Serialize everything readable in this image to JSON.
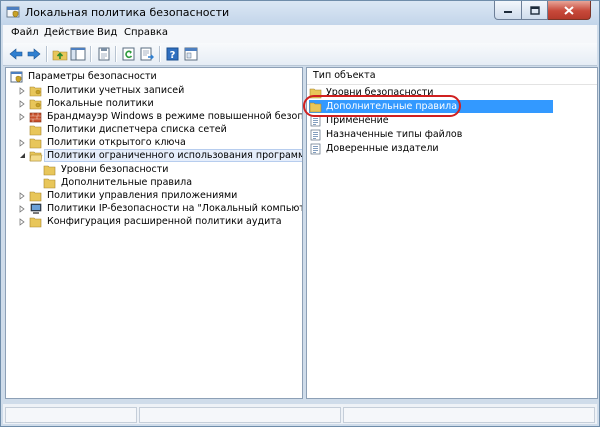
{
  "window": {
    "title": "Локальная политика безопасности"
  },
  "menu": [
    "Файл",
    "Действие",
    "Вид",
    "Справка"
  ],
  "toolbar": {
    "icons": [
      "back-arrow-icon",
      "forward-arrow-icon",
      "up-folder-icon",
      "show-tree-icon",
      "properties-icon",
      "refresh-icon",
      "export-list-icon",
      "help-icon",
      "console-icon"
    ]
  },
  "tree": {
    "root": "Параметры безопасности",
    "items": [
      {
        "label": "Политики учетных записей",
        "level": 1,
        "expander": "collapsed",
        "icon": "folder"
      },
      {
        "label": "Локальные политики",
        "level": 1,
        "expander": "collapsed",
        "icon": "folder"
      },
      {
        "label": "Брандмауэр Windows в режиме повышенной безопасности",
        "level": 1,
        "expander": "collapsed",
        "icon": "firewall"
      },
      {
        "label": "Политики диспетчера списка сетей",
        "level": 1,
        "expander": "none",
        "icon": "folder"
      },
      {
        "label": "Политики открытого ключа",
        "level": 1,
        "expander": "collapsed",
        "icon": "folder"
      },
      {
        "label": "Политики ограниченного использования программ",
        "level": 1,
        "expander": "expanded",
        "icon": "folder-open",
        "selected": true
      },
      {
        "label": "Уровни безопасности",
        "level": 2,
        "expander": "none",
        "icon": "folder"
      },
      {
        "label": "Дополнительные правила",
        "level": 2,
        "expander": "none",
        "icon": "folder"
      },
      {
        "label": "Политики управления приложениями",
        "level": 1,
        "expander": "collapsed",
        "icon": "folder"
      },
      {
        "label": "Политики IP-безопасности на \"Локальный компьютер\"",
        "level": 1,
        "expander": "collapsed",
        "icon": "ipsec"
      },
      {
        "label": "Конфигурация расширенной политики аудита",
        "level": 1,
        "expander": "collapsed",
        "icon": "folder"
      }
    ]
  },
  "list": {
    "column_header": "Тип объекта",
    "items": [
      {
        "label": "Уровни безопасности",
        "icon": "folder"
      },
      {
        "label": "Дополнительные правила",
        "icon": "folder",
        "highlighted": true
      },
      {
        "label": "Применение",
        "icon": "policy-document"
      },
      {
        "label": "Назначенные типы файлов",
        "icon": "policy-document"
      },
      {
        "label": "Доверенные издатели",
        "icon": "policy-document"
      }
    ]
  },
  "colors": {
    "selection": "#3399ff",
    "annotation": "#d02020",
    "folder": "#e8c65a"
  }
}
